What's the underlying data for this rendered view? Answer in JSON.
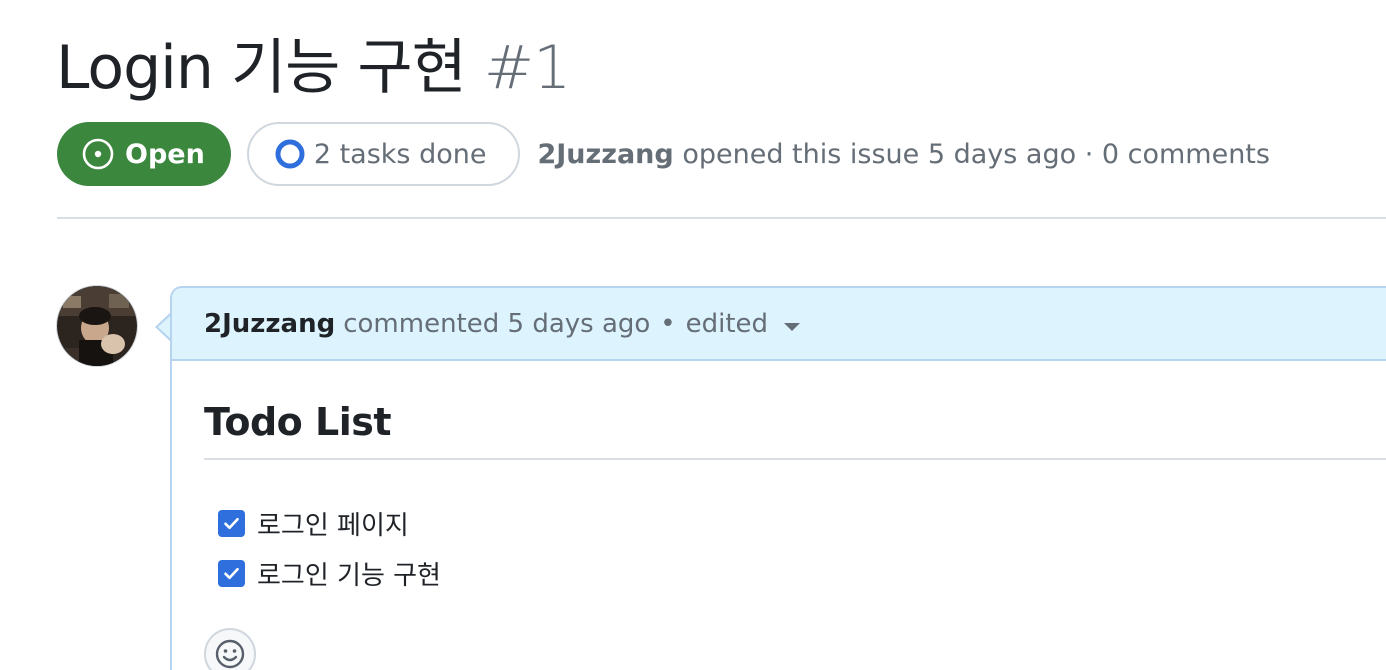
{
  "issue": {
    "title": "Login 기능 구현",
    "number": "#1",
    "state": "Open",
    "tasks_label": "2 tasks done",
    "author": "2Juzzang",
    "meta_suffix": "opened this issue 5 days ago · 0 comments"
  },
  "comment": {
    "author": "2Juzzang",
    "action": "commented 5 days ago",
    "separator": "•",
    "edited_label": "edited",
    "heading": "Todo List",
    "tasks": [
      {
        "label": "로그인 페이지",
        "checked": true
      },
      {
        "label": "로그인 기능 구현",
        "checked": true
      }
    ]
  },
  "colors": {
    "open_badge": "#3b873e",
    "comment_header_bg": "#ddf4ff",
    "checkbox": "#2f6fdd",
    "muted_text": "#656d76"
  },
  "icons": {
    "state": "issue-opened-icon",
    "tasks": "progress-circle-icon",
    "dropdown": "triangle-down-icon",
    "reaction": "smiley-icon",
    "checkbox": "checkbox-checked-icon"
  }
}
